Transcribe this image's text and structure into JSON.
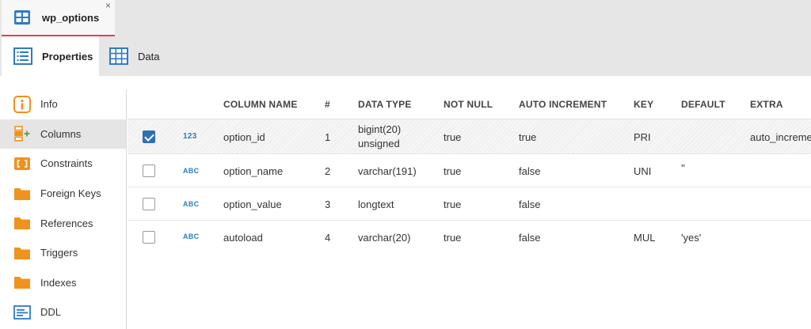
{
  "document_tab": {
    "label": "wp_options",
    "close": "×"
  },
  "subtabs": [
    {
      "label": "Properties",
      "active": true
    },
    {
      "label": "Data",
      "active": false
    }
  ],
  "nav": [
    {
      "label": "Info",
      "icon": "info-icon"
    },
    {
      "label": "Columns",
      "icon": "columns-icon",
      "selected": true
    },
    {
      "label": "Constraints",
      "icon": "constraints-icon"
    },
    {
      "label": "Foreign Keys",
      "icon": "folder-icon"
    },
    {
      "label": "References",
      "icon": "folder-icon"
    },
    {
      "label": "Triggers",
      "icon": "folder-icon"
    },
    {
      "label": "Indexes",
      "icon": "folder-icon"
    },
    {
      "label": "DDL",
      "icon": "ddl-icon"
    }
  ],
  "columns_table": {
    "headers": {
      "name": "COLUMN NAME",
      "num": "#",
      "type": "DATA TYPE",
      "not_null": "NOT NULL",
      "auto_inc": "AUTO INCREMENT",
      "key": "KEY",
      "default": "DEFAULT",
      "extra": "EXTRA"
    },
    "rows": [
      {
        "checked": true,
        "type_icon": "123",
        "name": "option_id",
        "num": "1",
        "type_line1": "bigint(20)",
        "type_line2": "unsigned",
        "not_null": "true",
        "auto_inc": "true",
        "key": "PRI",
        "default": "",
        "extra": "auto_increment"
      },
      {
        "checked": false,
        "type_icon": "ABC",
        "name": "option_name",
        "num": "2",
        "type_line1": "varchar(191)",
        "type_line2": "",
        "not_null": "true",
        "auto_inc": "false",
        "key": "UNI",
        "default": "''",
        "extra": ""
      },
      {
        "checked": false,
        "type_icon": "ABC",
        "name": "option_value",
        "num": "3",
        "type_line1": "longtext",
        "type_line2": "",
        "not_null": "true",
        "auto_inc": "false",
        "key": "",
        "default": "",
        "extra": ""
      },
      {
        "checked": false,
        "type_icon": "ABC",
        "name": "autoload",
        "num": "4",
        "type_line1": "varchar(20)",
        "type_line2": "",
        "not_null": "true",
        "auto_inc": "false",
        "key": "MUL",
        "default": "'yes'",
        "extra": ""
      }
    ]
  },
  "colors": {
    "accent_red": "#e0404a",
    "icon_blue": "#2e7bc6",
    "icon_orange": "#f0921e",
    "checkbox_blue": "#2f6fb6"
  }
}
